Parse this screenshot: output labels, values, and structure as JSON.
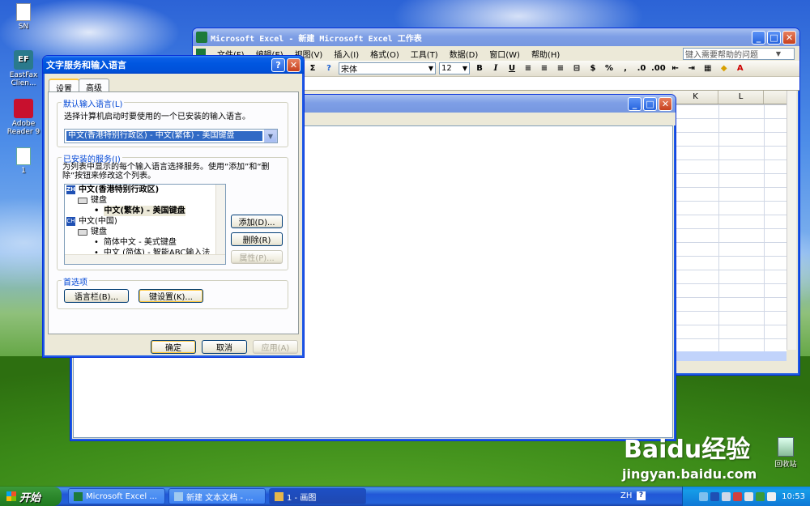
{
  "desktop": {
    "icons": [
      {
        "label": "SN"
      },
      {
        "label": "EastFax Clien..."
      },
      {
        "label": "Adobe Reader 9"
      },
      {
        "label": "1"
      }
    ],
    "recycle_bin": "回收站",
    "watermark": {
      "brand": "Baidu经验",
      "url": "jingyan.baidu.com"
    }
  },
  "excel": {
    "title": "Microsoft Excel - 新建 Microsoft Excel 工作表",
    "menus": [
      "文件(F)",
      "编辑(E)",
      "视图(V)",
      "插入(I)",
      "格式(O)",
      "工具(T)",
      "数据(D)",
      "窗口(W)",
      "帮助(H)"
    ],
    "help_placeholder": "键入需要帮助的问题",
    "font_name": "宋体",
    "font_size": "12",
    "sigma": "Σ",
    "bold": "B",
    "italic": "I",
    "underline": "U",
    "percent": "%",
    "comma": ",",
    "font_color_label": "A",
    "columns": [
      "K",
      "L"
    ]
  },
  "notepad": {
    "title": ""
  },
  "dialog": {
    "title": "文字服务和输入语言",
    "tabs": [
      "设置",
      "高级"
    ],
    "default_lang_group": "默认输入语言(L)",
    "default_lang_desc": "选择计算机启动时要使用的一个已安装的输入语言。",
    "default_lang_value": "中文(香港特别行政区) - 中文(繁体) - 美国键盘",
    "installed_group": "已安装的服务(I)",
    "installed_desc": "为列表中显示的每个输入语言选择服务。使用“添加”和“删除”按钮来修改这个列表。",
    "tree": [
      {
        "type": "lang",
        "badge": "ZH",
        "text": "中文(香港特别行政区)"
      },
      {
        "type": "kbd",
        "text": "键盘"
      },
      {
        "type": "item",
        "text": "中文(繁体) - 美国键盘"
      },
      {
        "type": "lang",
        "badge": "CH",
        "text": "中文(中国)"
      },
      {
        "type": "kbd",
        "text": "键盘"
      },
      {
        "type": "item",
        "text": "简体中文 - 美式键盘"
      },
      {
        "type": "item",
        "text": "中文 (简体) - 智能ABC输入法"
      }
    ],
    "add_button": "添加(D)...",
    "remove_button": "删除(R)",
    "properties_button": "属性(P)...",
    "prefs_group": "首选项",
    "langbar_button": "语言栏(B)...",
    "keysettings_button": "键设置(K)...",
    "ok_button": "确定",
    "cancel_button": "取消",
    "apply_button": "应用(A)"
  },
  "taskbar": {
    "start": "开始",
    "tasks": [
      "Microsoft Excel ...",
      "新建 文本文档 - ...",
      "1 - 画图"
    ],
    "lang_indicator": "ZH",
    "clock": "10:53"
  }
}
